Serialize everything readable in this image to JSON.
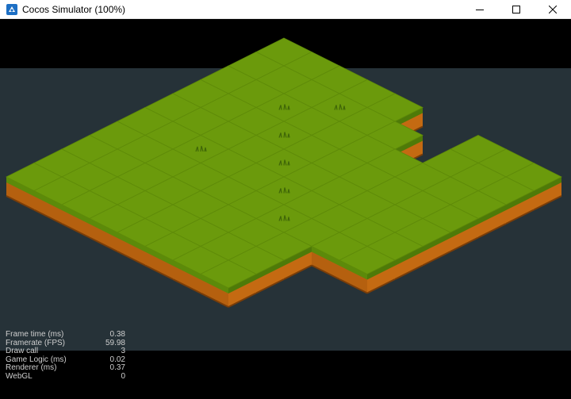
{
  "window": {
    "title": "Cocos Simulator (100%)",
    "app_icon": "cocos-app-icon",
    "buttons": {
      "minimize": "minimize-icon",
      "maximize": "maximize-icon",
      "close": "close-icon"
    }
  },
  "scene": {
    "sky_color": "#000000",
    "ground_color": "#263238",
    "grass_top_color": "#6b9a0c",
    "grass_side_color": "#4e7a08",
    "dirt_color": "#c46a12",
    "dirt_dark_color": "#7a3d08"
  },
  "stats": [
    {
      "label": "Frame time (ms)",
      "value": "0.38"
    },
    {
      "label": "Framerate (FPS)",
      "value": "59.98"
    },
    {
      "label": "Draw call",
      "value": "3"
    },
    {
      "label": "Game Logic (ms)",
      "value": "0.02"
    },
    {
      "label": "Renderer (ms)",
      "value": "0.37"
    },
    {
      "label": "WebGL",
      "value": "0"
    }
  ]
}
